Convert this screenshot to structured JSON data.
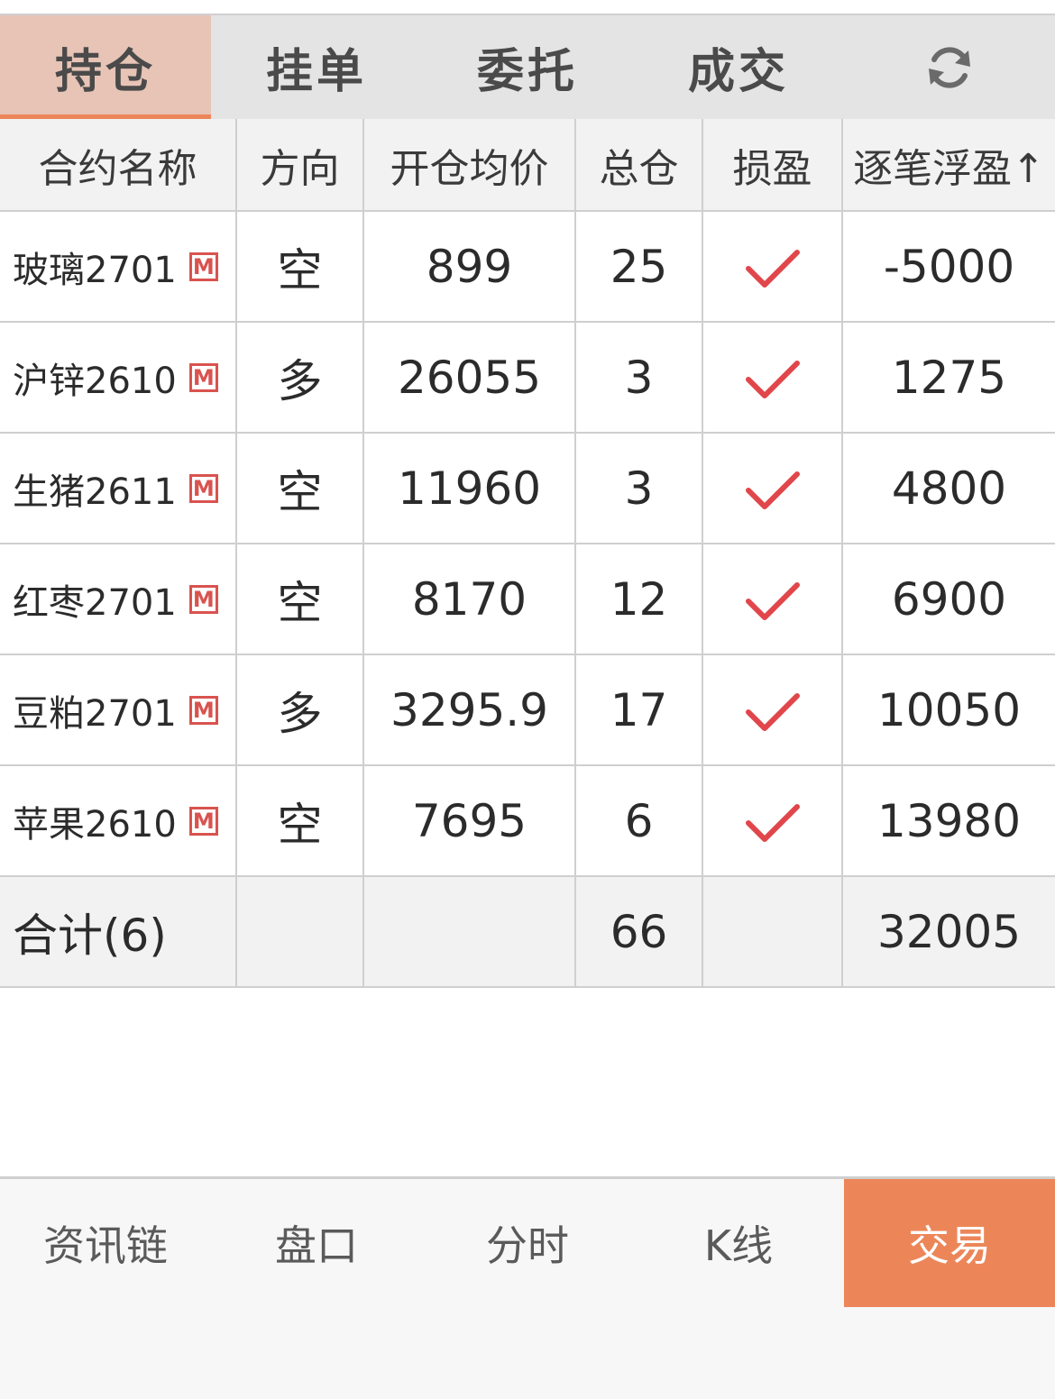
{
  "tabs": [
    {
      "label": "持仓"
    },
    {
      "label": "挂单"
    },
    {
      "label": "委托"
    },
    {
      "label": "成交"
    }
  ],
  "refresh_icon": "refresh-icon",
  "table": {
    "headers": [
      "合约名称",
      "方向",
      "开仓均价",
      "总仓",
      "损盈",
      "逐笔浮盈↑"
    ],
    "rows": [
      {
        "name": "玻璃2701",
        "badge": "M",
        "direction": "空",
        "avg_price": "899",
        "total": "25",
        "pnl": "-5000"
      },
      {
        "name": "沪锌2610",
        "badge": "M",
        "direction": "多",
        "avg_price": "26055",
        "total": "3",
        "pnl": "1275"
      },
      {
        "name": "生猪2611",
        "badge": "M",
        "direction": "空",
        "avg_price": "11960",
        "total": "3",
        "pnl": "4800"
      },
      {
        "name": "红枣2701",
        "badge": "M",
        "direction": "空",
        "avg_price": "8170",
        "total": "12",
        "pnl": "6900"
      },
      {
        "name": "豆粕2701",
        "badge": "M",
        "direction": "多",
        "avg_price": "3295.9",
        "total": "17",
        "pnl": "10050"
      },
      {
        "name": "苹果2610",
        "badge": "M",
        "direction": "空",
        "avg_price": "7695",
        "total": "6",
        "pnl": "13980"
      }
    ],
    "total_row": {
      "label": "合计(6)",
      "total": "66",
      "pnl": "32005"
    }
  },
  "bottom_nav": [
    {
      "label": "资讯链"
    },
    {
      "label": "盘口"
    },
    {
      "label": "分时"
    },
    {
      "label": "K线"
    },
    {
      "label": "交易"
    }
  ],
  "colors": {
    "accent": "#ec8659",
    "active_tab_bg": "#e7c4b6",
    "profit_red": "#d9534f",
    "loss_green": "#2e8b57"
  }
}
